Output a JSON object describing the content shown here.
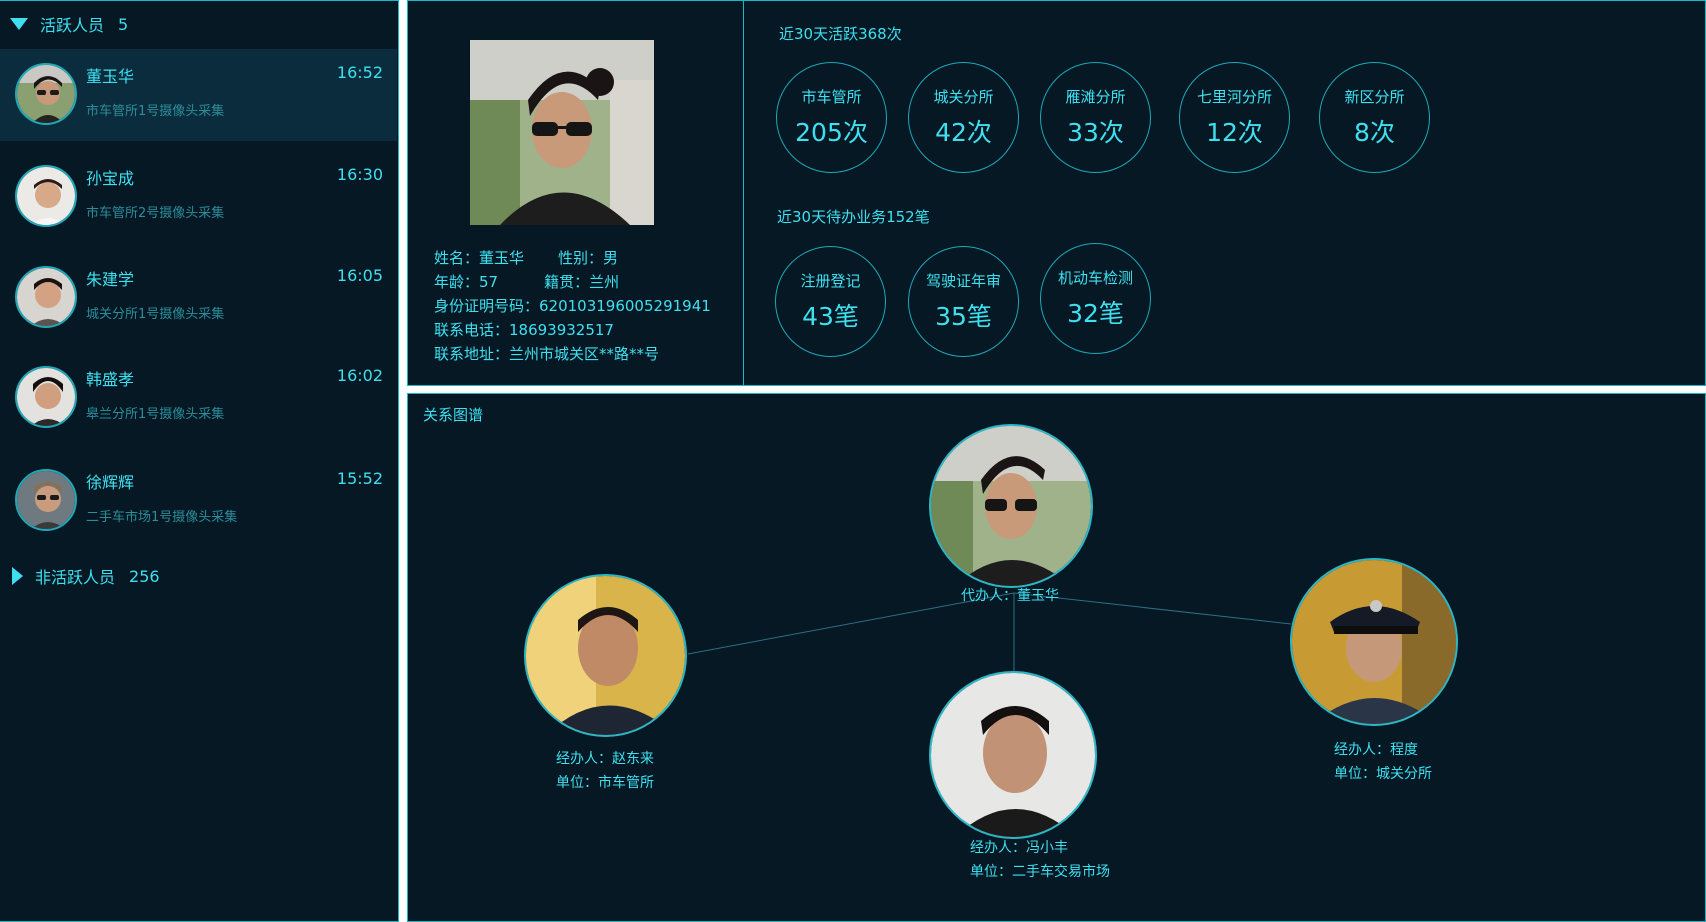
{
  "sidebar": {
    "active_group": {
      "label": "活跃人员",
      "count": "5"
    },
    "inactive_group": {
      "label": "非活跃人员",
      "count": "256"
    },
    "people": [
      {
        "name": "董玉华",
        "time": "16:52",
        "source": "市车管所1号摄像头采集",
        "active": true
      },
      {
        "name": "孙宝成",
        "time": "16:30",
        "source": "市车管所2号摄像头采集",
        "active": false
      },
      {
        "name": "朱建学",
        "time": "16:05",
        "source": "城关分所1号摄像头采集",
        "active": false
      },
      {
        "name": "韩盛孝",
        "time": "16:02",
        "source": "皋兰分所1号摄像头采集",
        "active": false
      },
      {
        "name": "徐辉辉",
        "time": "15:52",
        "source": "二手车市场1号摄像头采集",
        "active": false
      }
    ]
  },
  "profile": {
    "name_line": "姓名：董玉华",
    "gender_line": "性别：男",
    "age_line": "年龄：57",
    "origin_line": "籍贯：兰州",
    "id_line": "身份证明号码：620103196005291941",
    "phone_line": "联系电话：18693932517",
    "address_line": "联系地址：兰州市城关区**路**号"
  },
  "activity": {
    "title": "近30天活跃368次",
    "stats": [
      {
        "label": "市车管所",
        "value": "205次"
      },
      {
        "label": "城关分所",
        "value": "42次"
      },
      {
        "label": "雁滩分所",
        "value": "33次"
      },
      {
        "label": "七里河分所",
        "value": "12次"
      },
      {
        "label": "新区分所",
        "value": "8次"
      }
    ]
  },
  "business": {
    "title": "近30天待办业务152笔",
    "stats": [
      {
        "label": "注册登记",
        "value": "43笔"
      },
      {
        "label": "驾驶证年审",
        "value": "35笔"
      },
      {
        "label": "机动车检测",
        "value": "32笔"
      }
    ]
  },
  "graph": {
    "title": "关系图谱",
    "center": {
      "line1": "代办人：董玉华"
    },
    "left": {
      "line1": "经办人：赵东来",
      "line2": "单位：市车管所"
    },
    "bottom": {
      "line1": "经办人：冯小丰",
      "line2": "单位：二手车交易市场"
    },
    "right": {
      "line1": "经办人：程度",
      "line2": "单位：城关分所"
    }
  },
  "colors": {
    "accent": "#3ee0f0",
    "panel_bg": "#051824",
    "border": "#17b6c8",
    "active_row": "#0b2c3c"
  }
}
